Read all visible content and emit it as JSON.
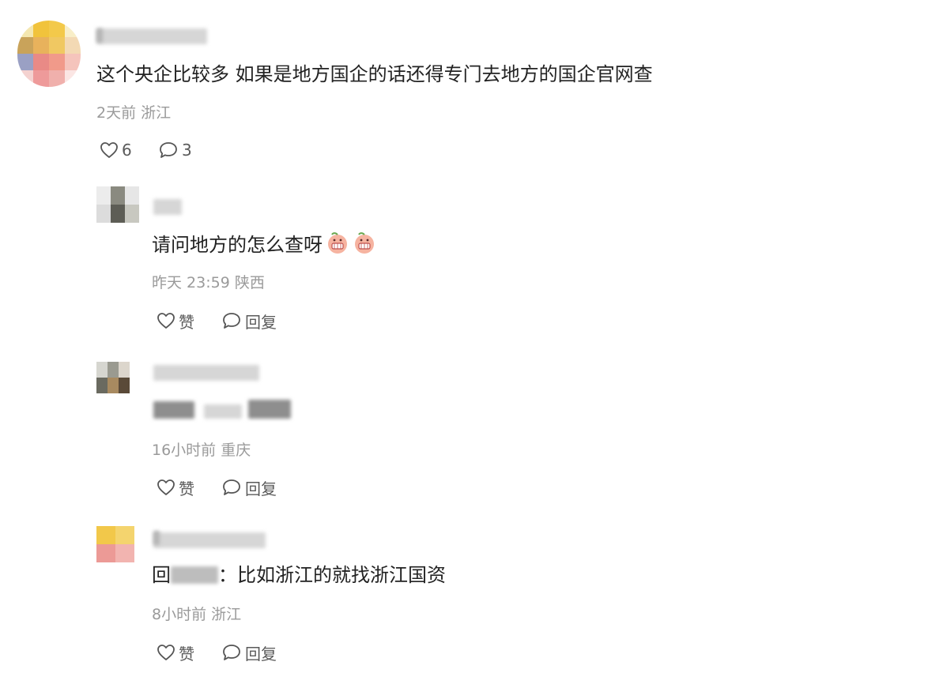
{
  "comment": {
    "text": "这个央企比较多 如果是地方国企的话还得专门去地方的国企官网查",
    "meta": "2天前 浙江",
    "likes": "6",
    "replies_count": "3"
  },
  "replies": [
    {
      "text": "请问地方的怎么查呀",
      "emoji_icons": [
        "grimacing-peach-emoji",
        "grimacing-peach-emoji"
      ],
      "meta": "昨天 23:59 陕西",
      "like_label": "赞",
      "reply_label": "回复"
    },
    {
      "text": "",
      "meta": "16小时前 重庆",
      "like_label": "赞",
      "reply_label": "回复"
    },
    {
      "text_prefix": "回",
      "text_suffix": "：比如浙江的就找浙江国资",
      "meta": "8小时前 浙江",
      "like_label": "赞",
      "reply_label": "回复"
    }
  ],
  "icons": {
    "like": "heart-outline-icon",
    "reply": "speech-bubble-outline-icon"
  },
  "colors": {
    "text": "#222222",
    "meta": "#9a9a9a",
    "action": "#5a5a5a"
  }
}
